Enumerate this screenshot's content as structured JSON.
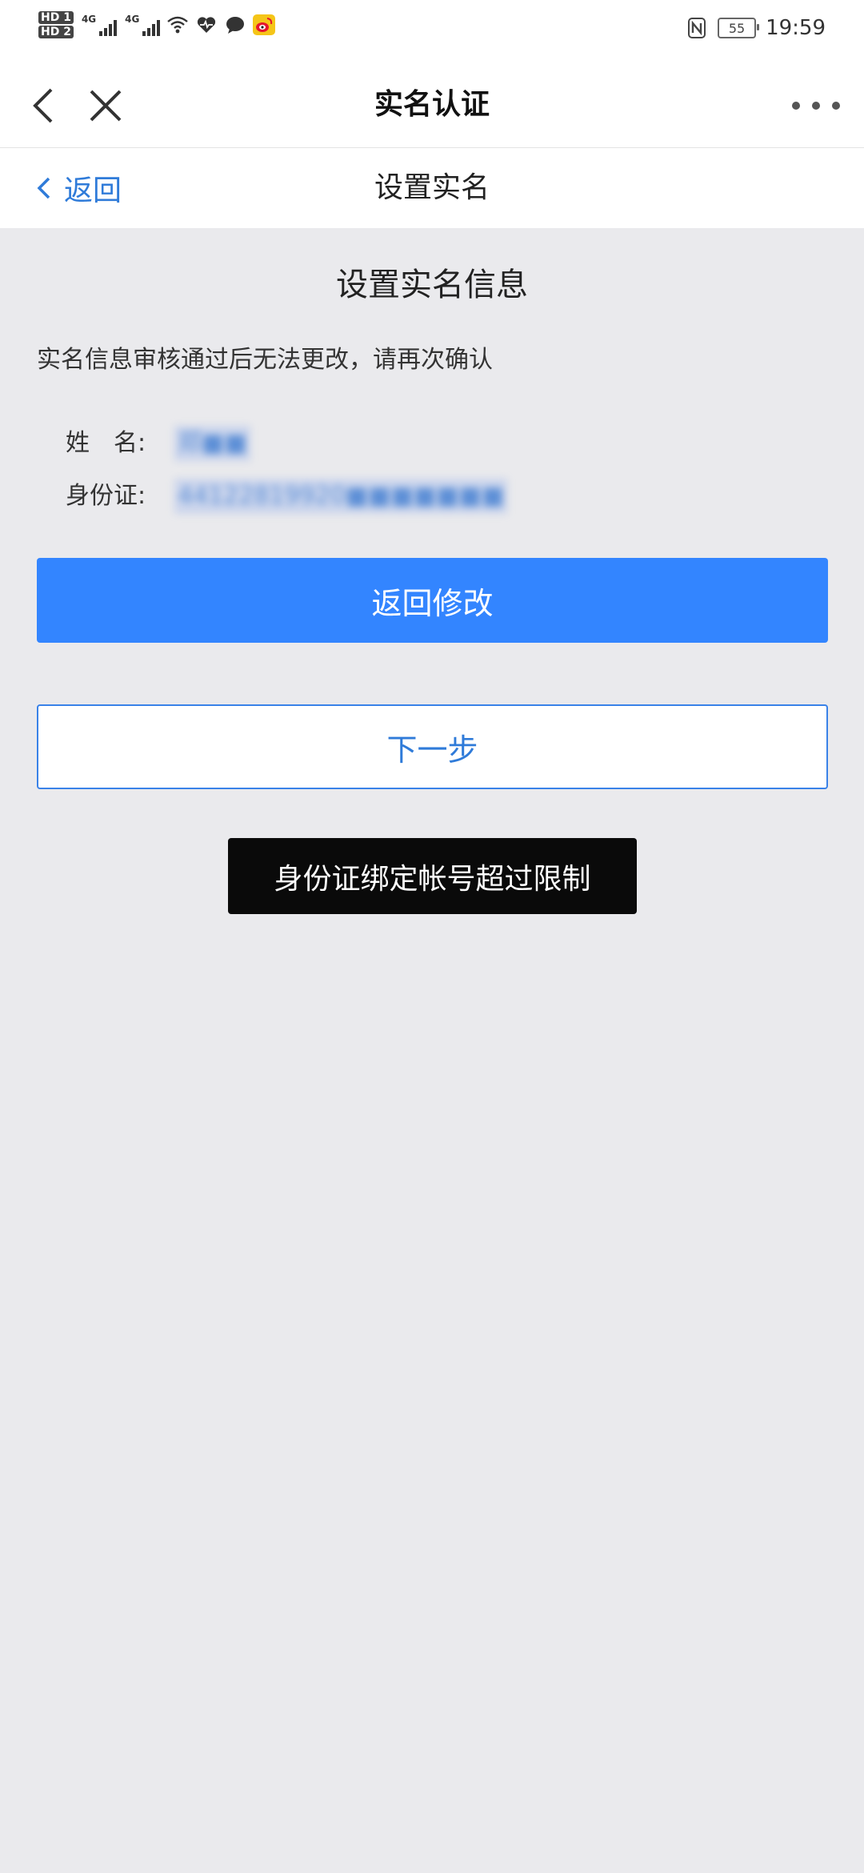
{
  "status_bar": {
    "sim1": "HD 1",
    "sim2": "HD 2",
    "net1": "4G",
    "net2": "4G",
    "battery": "55",
    "time": "19:59",
    "icons": [
      "wifi-icon",
      "health-icon",
      "message-icon",
      "weibo-icon",
      "nfc-icon"
    ]
  },
  "navbar": {
    "title": "实名认证"
  },
  "subbar": {
    "back_label": "返回",
    "title": "设置实名"
  },
  "content": {
    "heading": "设置实名信息",
    "notice": "实名信息审核通过后无法更改，请再次确认",
    "name_label": "姓　名:",
    "name_value": "郑■■",
    "id_label": "身份证:",
    "id_value": "44122819920■■■■■■■"
  },
  "buttons": {
    "primary": "返回修改",
    "secondary": "下一步"
  },
  "toast": {
    "message": "身份证绑定帐号超过限制"
  },
  "colors": {
    "accent": "#3385ff",
    "link": "#2f7bd9",
    "background": "#eaeaed",
    "toast_bg": "#0a0a0a"
  }
}
